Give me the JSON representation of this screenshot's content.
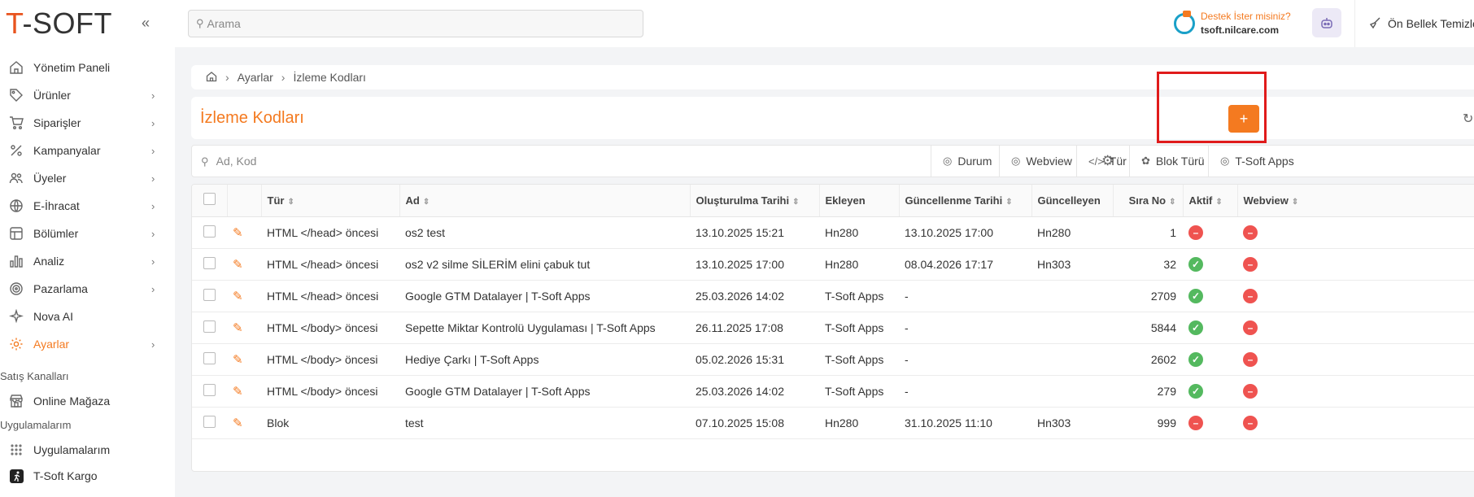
{
  "brand": {
    "logo_first": "T",
    "logo_rest": "-SOFT"
  },
  "sidebar": {
    "items": [
      {
        "label": "Yönetim Paneli",
        "icon": "home-icon",
        "chevron": false
      },
      {
        "label": "Ürünler",
        "icon": "tag-icon",
        "chevron": true
      },
      {
        "label": "Siparişler",
        "icon": "cart-icon",
        "chevron": true
      },
      {
        "label": "Kampanyalar",
        "icon": "percent-icon",
        "chevron": true
      },
      {
        "label": "Üyeler",
        "icon": "users-icon",
        "chevron": true
      },
      {
        "label": "E-İhracat",
        "icon": "globe-icon",
        "chevron": true
      },
      {
        "label": "Bölümler",
        "icon": "layout-icon",
        "chevron": true
      },
      {
        "label": "Analiz",
        "icon": "chart-icon",
        "chevron": true
      },
      {
        "label": "Pazarlama",
        "icon": "target-icon",
        "chevron": true
      },
      {
        "label": "Nova AI",
        "icon": "sparkle-icon",
        "chevron": false
      },
      {
        "label": "Ayarlar",
        "icon": "gear-icon",
        "chevron": true,
        "active": true
      }
    ],
    "section_sales": "Satış Kanalları",
    "online_store": "Online Mağaza",
    "section_apps": "Uygulamalarım",
    "my_apps": "Uygulamalarım",
    "tsoft_cargo": "T-Soft Kargo"
  },
  "topbar": {
    "search_placeholder": "Arama",
    "support_line1": "Destek İster misiniz?",
    "support_line2": "tsoft.nilcare.com",
    "cache_label": "Ön Bellek Temizle"
  },
  "breadcrumb": {
    "level1": "Ayarlar",
    "level2": "İzleme Kodları"
  },
  "page": {
    "title": "İzleme Kodları",
    "add_label": "+"
  },
  "filters": {
    "search_placeholder": "Ad, Kod",
    "status": "Durum",
    "webview": "Webview",
    "type": "Tür",
    "block_type": "Blok Türü",
    "tsoft_apps": "T-Soft Apps"
  },
  "table": {
    "headers": {
      "type": "Tür",
      "name": "Ad",
      "created": "Oluşturulma Tarihi",
      "added_by": "Ekleyen",
      "updated": "Güncellenme Tarihi",
      "updated_by": "Güncelleyen",
      "order": "Sıra No",
      "active": "Aktif",
      "webview": "Webview"
    },
    "rows": [
      {
        "type": "HTML </head> öncesi",
        "name": "os2 test",
        "created": "13.10.2025 15:21",
        "added_by": "Hn280",
        "updated": "13.10.2025 17:00",
        "updated_by": "Hn280",
        "order": "1",
        "active": false,
        "webview": false
      },
      {
        "type": "HTML </head> öncesi",
        "name": "os2 v2 silme SİLERİM elini çabuk tut",
        "created": "13.10.2025 17:00",
        "added_by": "Hn280",
        "updated": "08.04.2026 17:17",
        "updated_by": "Hn303",
        "order": "32",
        "active": true,
        "webview": false
      },
      {
        "type": "HTML </head> öncesi",
        "name": "Google GTM Datalayer | T-Soft Apps",
        "created": "25.03.2026 14:02",
        "added_by": "T-Soft Apps",
        "updated": "-",
        "updated_by": "",
        "order": "2709",
        "active": true,
        "webview": false
      },
      {
        "type": "HTML </body> öncesi",
        "name": "Sepette Miktar Kontrolü Uygulaması | T-Soft Apps",
        "created": "26.11.2025 17:08",
        "added_by": "T-Soft Apps",
        "updated": "-",
        "updated_by": "",
        "order": "5844",
        "active": true,
        "webview": false
      },
      {
        "type": "HTML </body> öncesi",
        "name": "Hediye Çarkı | T-Soft Apps",
        "created": "05.02.2026 15:31",
        "added_by": "T-Soft Apps",
        "updated": "-",
        "updated_by": "",
        "order": "2602",
        "active": true,
        "webview": false
      },
      {
        "type": "HTML </body> öncesi",
        "name": "Google GTM Datalayer | T-Soft Apps",
        "created": "25.03.2026 14:02",
        "added_by": "T-Soft Apps",
        "updated": "-",
        "updated_by": "",
        "order": "279",
        "active": true,
        "webview": false
      },
      {
        "type": "Blok",
        "name": "test",
        "created": "07.10.2025 15:08",
        "added_by": "Hn280",
        "updated": "31.10.2025 11:10",
        "updated_by": "Hn303",
        "order": "999",
        "active": false,
        "webview": false
      }
    ]
  },
  "colors": {
    "accent": "#f47a20",
    "active_on": "#54b95f",
    "active_off": "#ef5350",
    "highlight_box": "#e01b1b"
  }
}
